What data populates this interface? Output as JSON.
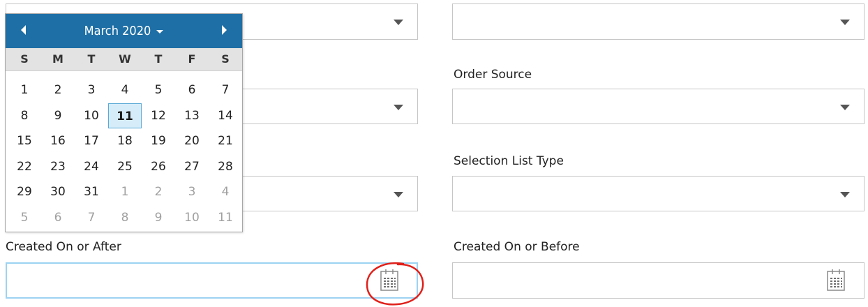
{
  "form": {
    "order_source_label": "Order Source",
    "selection_list_type_label": "Selection List Type",
    "created_after_label": "Created On or After",
    "created_after_value": "",
    "created_before_label": "Created On or Before",
    "created_before_value": ""
  },
  "datepicker": {
    "title": "March 2020",
    "weekdays": [
      "S",
      "M",
      "T",
      "W",
      "T",
      "F",
      "S"
    ],
    "weeks": [
      [
        "1",
        "2",
        "3",
        "4",
        "5",
        "6",
        "7"
      ],
      [
        "8",
        "9",
        "10",
        "11",
        "12",
        "13",
        "14"
      ],
      [
        "15",
        "16",
        "17",
        "18",
        "19",
        "20",
        "21"
      ],
      [
        "22",
        "23",
        "24",
        "25",
        "26",
        "27",
        "28"
      ],
      [
        "29",
        "30",
        "31",
        "1",
        "2",
        "3",
        "4"
      ],
      [
        "5",
        "6",
        "7",
        "8",
        "9",
        "10",
        "11"
      ]
    ],
    "today": "11",
    "header_color": "#1e6fa5"
  },
  "icons": {
    "calendar_icon": "calendar-icon",
    "prev_icon": "chevron-left-icon",
    "next_icon": "chevron-right-icon"
  },
  "annotation_color": "#e0201a"
}
